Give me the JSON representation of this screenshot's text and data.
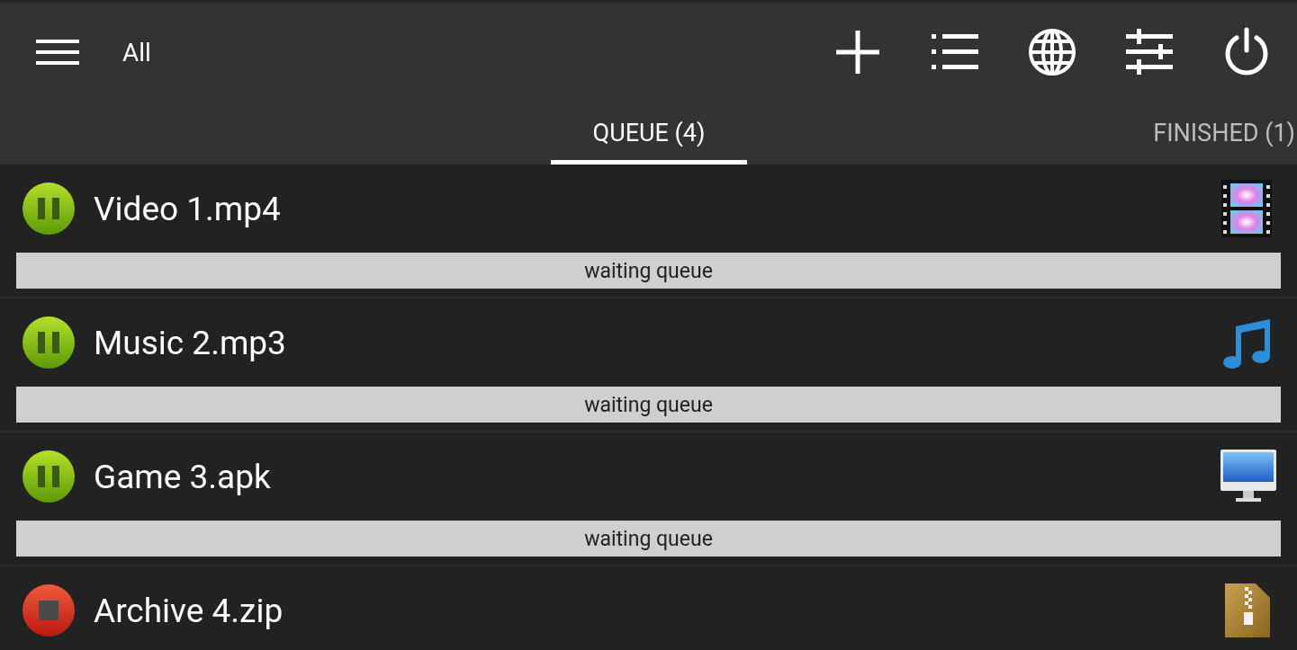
{
  "toolbar": {
    "title": "All",
    "actions": [
      {
        "kind": "add"
      },
      {
        "kind": "list"
      },
      {
        "kind": "globe"
      },
      {
        "kind": "sliders"
      },
      {
        "kind": "power"
      }
    ]
  },
  "tabs": [
    {
      "label": "QUEUE (4)",
      "selected": true
    },
    {
      "label": "FINISHED (1)",
      "selected": false
    }
  ],
  "downloads": [
    {
      "name": "Video 1.mp4",
      "kind": "paused",
      "file_icon": {
        "kind": "video"
      },
      "status": "waiting queue"
    },
    {
      "name": "Music 2.mp3",
      "kind": "paused",
      "file_icon": {
        "kind": "audio"
      },
      "status": "waiting queue"
    },
    {
      "name": "Game 3.apk",
      "kind": "paused",
      "file_icon": {
        "kind": "app"
      },
      "status": "waiting queue"
    },
    {
      "name": "Archive 4.zip",
      "kind": "stopped",
      "file_icon": {
        "kind": "archive"
      }
    }
  ]
}
